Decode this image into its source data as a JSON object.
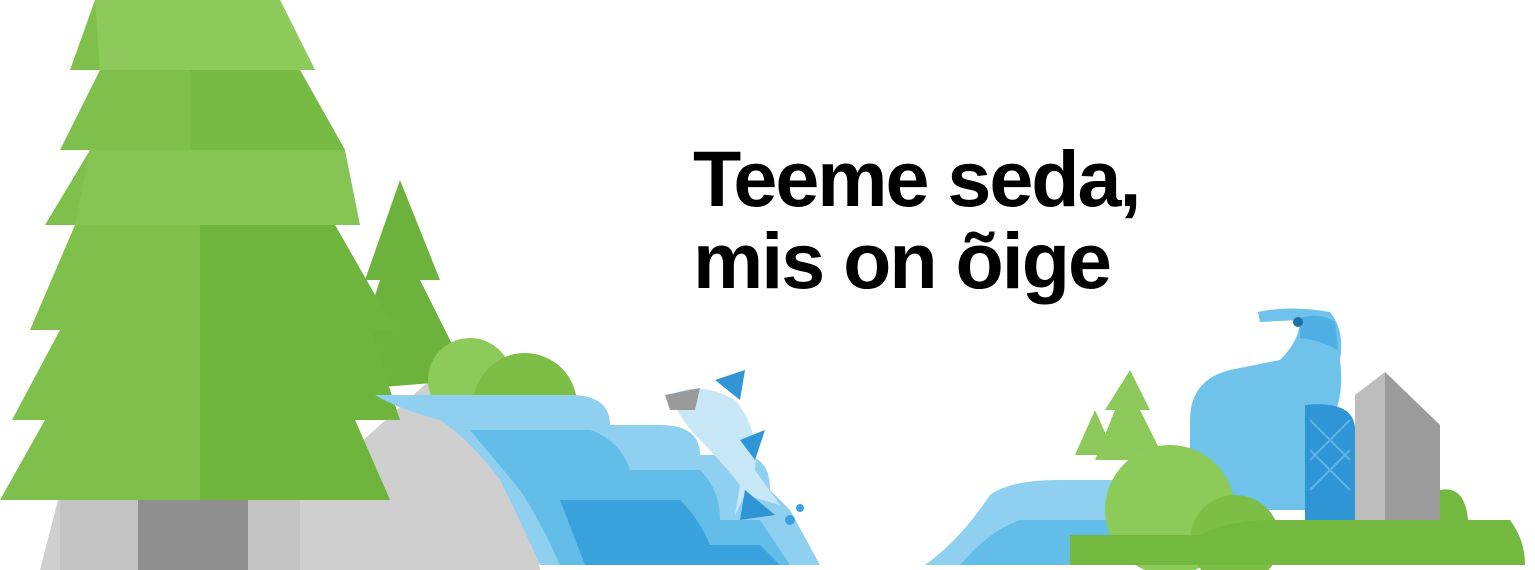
{
  "headline": {
    "line1": "Teeme seda,",
    "line2": "mis on õige"
  },
  "illustration": {
    "elements": [
      "forest-illustration",
      "waterfall-illustration",
      "fish-illustration",
      "beaver-illustration",
      "rock-illustration",
      "bush-illustration"
    ]
  },
  "colors": {
    "background": "#ffffff",
    "tree_light": "#8cc85a",
    "tree_mid": "#72b63e",
    "tree_dark": "#5ea62f",
    "water_light": "#a9dbf4",
    "water_mid": "#62bde8",
    "water_dark": "#3aa3de",
    "rock_light": "#c9c9c9",
    "rock_dark": "#8f8f8f",
    "beaver": "#6fc3ea",
    "beaver_dark": "#2f95d5",
    "text": "#000000"
  }
}
